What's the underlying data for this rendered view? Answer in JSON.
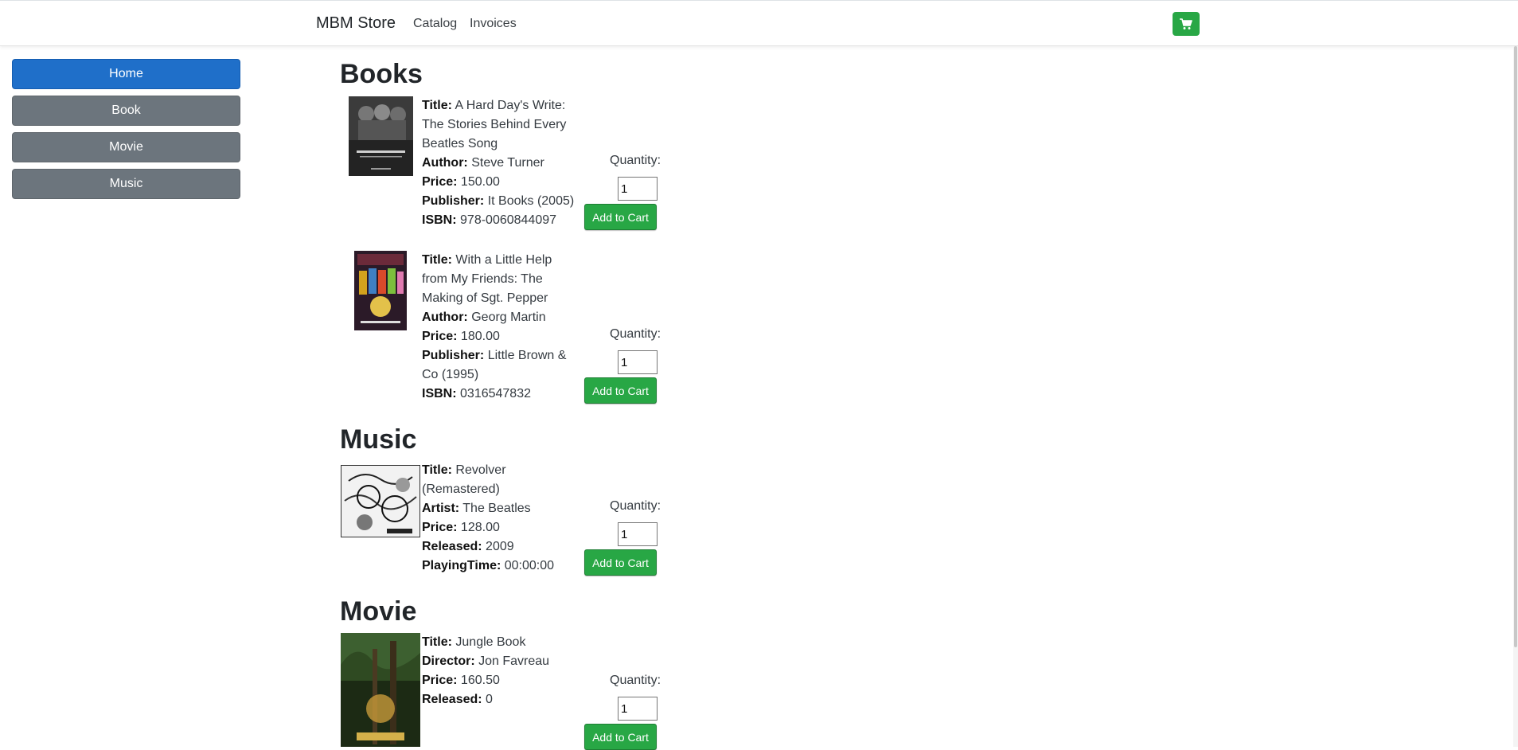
{
  "navbar": {
    "brand": "MBM Store",
    "links": [
      "Catalog",
      "Invoices"
    ],
    "cart_icon": "shopping-cart-icon"
  },
  "sidebar": {
    "items": [
      {
        "label": "Home",
        "active": true
      },
      {
        "label": "Book",
        "active": false
      },
      {
        "label": "Movie",
        "active": false
      },
      {
        "label": "Music",
        "active": false
      }
    ]
  },
  "common": {
    "quantity_label": "Quantity:",
    "add_to_cart": "Add to Cart",
    "default_quantity": "1"
  },
  "books": {
    "heading": "Books",
    "items": [
      {
        "title_lines": [
          "A Hard Day's Write:",
          "The Stories Behind Every",
          "Beatles Song"
        ],
        "author": "Steve Turner",
        "price": "150.00",
        "publisher_lines": [
          "It Books (2005)"
        ],
        "isbn": "978-0060844097"
      },
      {
        "title_lines": [
          "With a Little Help",
          "from My Friends: The",
          "Making of Sgt. Pepper"
        ],
        "author": "Georg Martin",
        "price": "180.00",
        "publisher_lines": [
          "Little Brown &",
          "Co (1995)"
        ],
        "isbn": "0316547832"
      }
    ]
  },
  "music": {
    "heading": "Music",
    "items": [
      {
        "title_lines": [
          "Revolver",
          "(Remastered)"
        ],
        "artist": "The Beatles",
        "price": "128.00",
        "released": "2009",
        "playing_time": "00:00:00"
      }
    ]
  },
  "movie": {
    "heading": "Movie",
    "items": [
      {
        "title": "Jungle Book",
        "director": "Jon Favreau",
        "price": "160.50",
        "released": "0"
      }
    ]
  },
  "colors": {
    "primary": "#1f6fc9",
    "secondary": "#6c757d",
    "success": "#28a745"
  }
}
